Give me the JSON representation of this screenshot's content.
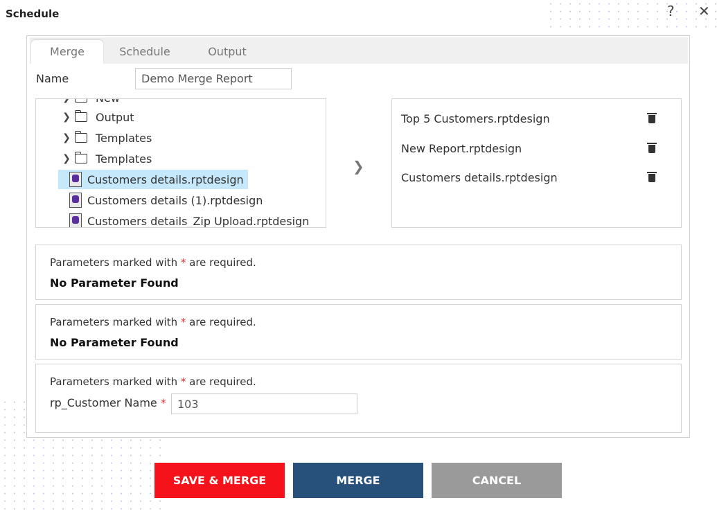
{
  "header": {
    "title": "Schedule",
    "help_icon": "?",
    "close_icon": "✕"
  },
  "tabs": [
    {
      "label": "Merge",
      "active": true
    },
    {
      "label": "Schedule",
      "active": false
    },
    {
      "label": "Output",
      "active": false
    }
  ],
  "name_field": {
    "label": "Name",
    "value": "Demo Merge Report"
  },
  "tree": {
    "folders": [
      "New",
      "Output",
      "Templates",
      "Templates"
    ],
    "files": [
      "Customers details.rptdesign",
      "Customers details (1).rptdesign",
      "Customers details_Zip Upload.rptdesign"
    ],
    "selected": "Customers details.rptdesign"
  },
  "selected_reports": [
    "Top 5 Customers.rptdesign",
    "New Report.rptdesign",
    "Customers details.rptdesign"
  ],
  "parameter_panels": [
    {
      "required_text_pre": "Parameters marked with ",
      "star": "*",
      "required_text_post": " are required.",
      "message": "No Parameter Found"
    },
    {
      "required_text_pre": "Parameters marked with ",
      "star": "*",
      "required_text_post": " are required.",
      "message": "No Parameter Found"
    },
    {
      "required_text_pre": "Parameters marked with ",
      "star": "*",
      "required_text_post": " are required.",
      "param_label": "rp_Customer Name",
      "param_value": "103"
    }
  ],
  "buttons": {
    "save_merge": "SAVE & MERGE",
    "merge": "MERGE",
    "cancel": "CANCEL"
  },
  "colors": {
    "save_merge": "#f5121a",
    "merge": "#27517a",
    "cancel": "#9a9a9a",
    "selected_row": "#c5e9fb"
  }
}
